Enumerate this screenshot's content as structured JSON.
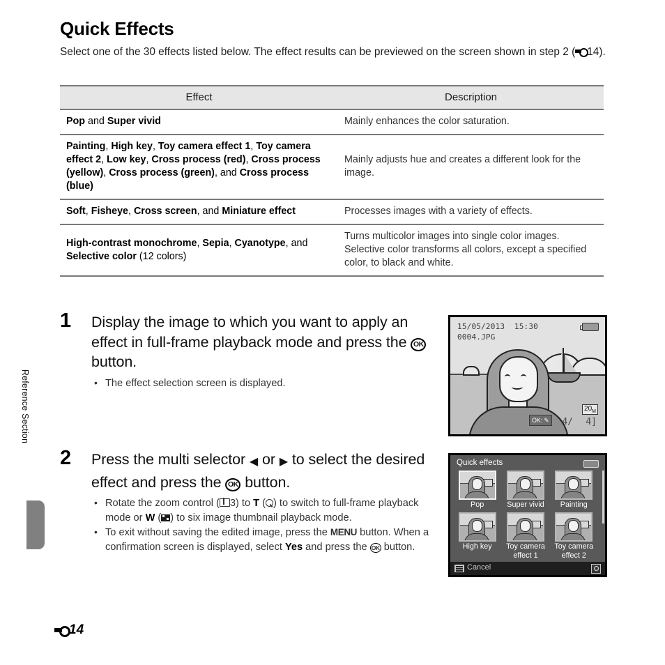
{
  "page": {
    "title": "Quick Effects",
    "intro_pre": "Select one of the 30 effects listed below. The effect results can be previewed on the screen shown in step 2 (",
    "intro_post": "14).",
    "side_label": "Reference Section",
    "footer_page": "14"
  },
  "table": {
    "headers": [
      "Effect",
      "Description"
    ],
    "rows": [
      {
        "effect_html": "<b>Pop</b> and <b>Super vivid</b>",
        "description": "Mainly enhances the color saturation."
      },
      {
        "effect_html": "<b>Painting</b>, <b>High key</b>, <b>Toy camera effect 1</b>, <b>Toy camera effect 2</b>, <b>Low key</b>, <b>Cross process (red)</b>, <b>Cross process (yellow)</b>, <b>Cross process (green)</b>, and <b>Cross process (blue)</b>",
        "description": "Mainly adjusts hue and creates a different look for the image."
      },
      {
        "effect_html": "<b>Soft</b>, <b>Fisheye</b>, <b>Cross screen</b>, and <b>Miniature effect</b>",
        "description": "Processes images with a variety of effects."
      },
      {
        "effect_html": "<b>High-contrast monochrome</b>, <b>Sepia</b>, <b>Cyanotype</b>, and <b>Selective color</b> (12 colors)",
        "description": "Turns multicolor images into single color images. Selective color transforms all colors, except a specified color, to black and white."
      }
    ]
  },
  "steps": [
    {
      "number": "1",
      "heading_html": "Display the image to which you want to apply an effect in full-frame playback mode and press the <span class=\"okbtn\">OK</span> button.",
      "bullets_html": [
        "The effect selection screen is displayed."
      ]
    },
    {
      "number": "2",
      "heading_html": "Press the multi selector <span class=\"arrw\">◀</span> or <span class=\"arrw\">▶</span> to select the desired effect and press the <span class=\"okbtn\">OK</span> button.",
      "bullets_html": [
        "Rotate the zoom control (<span class=\"bookico\"></span>3) to <b>T</b> (<span class=\"magico\"></span>) to switch to full-frame playback mode or <b>W</b> (<span class=\"thumbico\"></span>) to six image thumbnail playback mode.",
        "To exit without saving the edited image, press the <span class=\"menu-g\">MENU</span> button. When a confirmation screen is displayed, select <b>Yes</b> and press the <span class=\"okbtn sm\">OK</span> button."
      ]
    }
  ],
  "lcd_playback": {
    "date": "15/05/2013",
    "time": "15:30",
    "filename": "0004.JPG",
    "ok_hint": "OK:",
    "frame_current": "4/",
    "frame_total": "4",
    "image_size": "20"
  },
  "lcd_quick_effects": {
    "title": "Quick effects",
    "cancel_label": "Cancel",
    "effects": [
      {
        "label": "Pop",
        "selected": true
      },
      {
        "label": "Super vivid",
        "selected": false
      },
      {
        "label": "Painting",
        "selected": false
      },
      {
        "label": "High key",
        "selected": false
      },
      {
        "label": "Toy camera effect 1",
        "selected": false
      },
      {
        "label": "Toy camera effect 2",
        "selected": false
      }
    ]
  },
  "colors": {
    "rule": "#7a7a7a",
    "header_bg": "#e6e6e6",
    "tab_gray": "#808080",
    "lcd_menu_bg": "#595959"
  }
}
